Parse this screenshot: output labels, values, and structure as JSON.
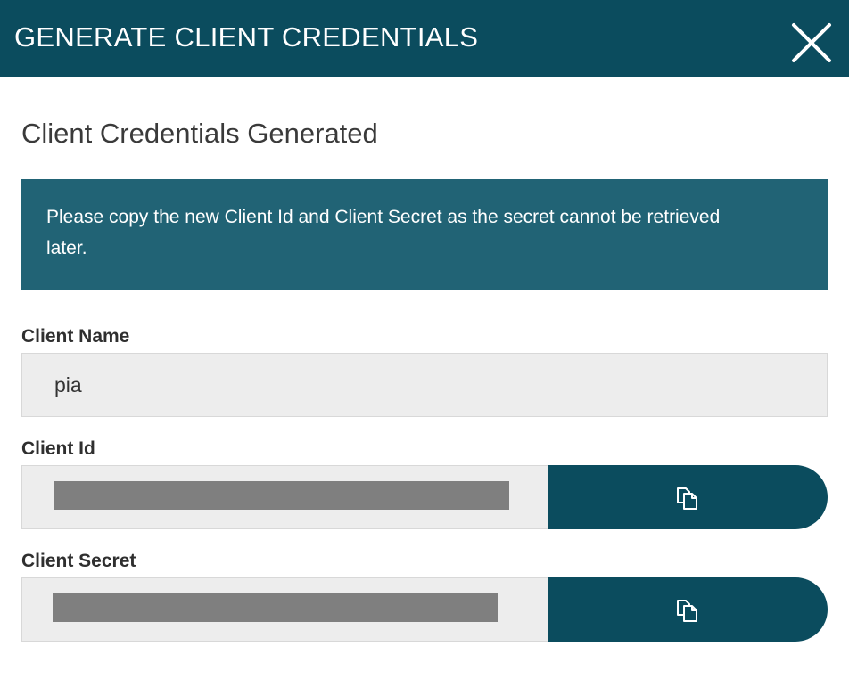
{
  "header": {
    "title": "GENERATE CLIENT CREDENTIALS",
    "close_icon": "close-icon"
  },
  "subtitle": "Client Credentials Generated",
  "notice": {
    "text": "Please copy the new Client Id and Client Secret as the secret cannot be retrieved later."
  },
  "fields": {
    "client_name": {
      "label": "Client Name",
      "value": "pia"
    },
    "client_id": {
      "label": "Client Id",
      "copy_icon": "copy-icon"
    },
    "client_secret": {
      "label": "Client Secret",
      "copy_icon": "copy-icon"
    }
  },
  "colors": {
    "header_bg": "#0b4c5e",
    "notice_bg": "#216375",
    "button_bg": "#0b4c5e",
    "field_bg": "#ededed",
    "redaction": "#7f7f7f"
  }
}
